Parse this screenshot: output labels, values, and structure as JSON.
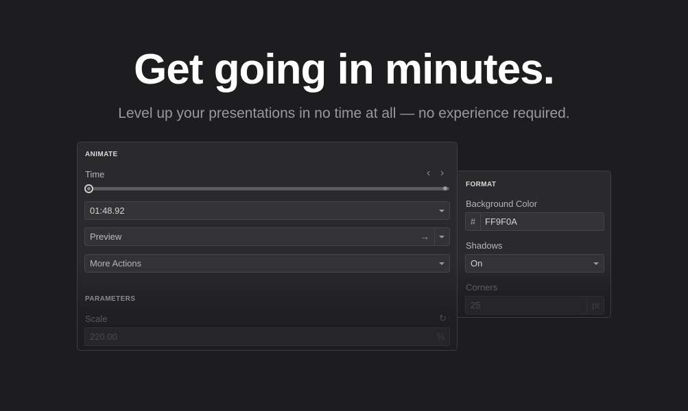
{
  "hero": {
    "title": "Get going in minutes.",
    "subtitle": "Level up your presentations in no time at all — no experience required."
  },
  "animate_panel": {
    "heading": "ANIMATE",
    "time_label": "Time",
    "time_value": "01:48.92",
    "slider_position": 0,
    "preview_label": "Preview",
    "more_actions_label": "More Actions",
    "parameters_heading": "PARAMETERS",
    "scale_label": "Scale",
    "scale_value": "220.00",
    "scale_unit": "%"
  },
  "format_panel": {
    "heading": "FORMAT",
    "background_color_label": "Background Color",
    "hash_symbol": "#",
    "background_color_value": "FF9F0A",
    "shadows_label": "Shadows",
    "shadows_value": "On",
    "corners_label": "Corners",
    "corners_value": "25",
    "corners_unit": "pt"
  },
  "icons": {
    "prev": "chevron-left-icon",
    "next": "chevron-right-icon",
    "dropdown": "chevron-down-icon",
    "go": "arrow-right-icon",
    "reset": "reset-icon"
  },
  "colors": {
    "background": "#1d1d1f",
    "panel": "#2a2a2c",
    "field": "#333336"
  }
}
